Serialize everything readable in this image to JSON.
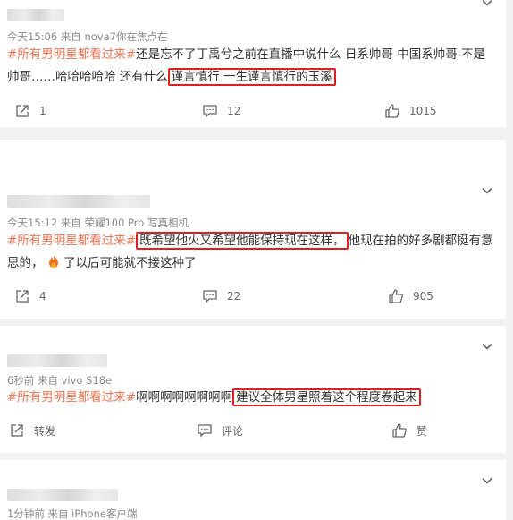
{
  "comments": [
    {
      "source": "今天15:06  来自 nova7你在焦点在",
      "topic": "#所有男明星都看过来#",
      "text_before": "还是忘不了丁禹兮之前在直播中说什么 日系帅哥 中国系帅哥 不是帅哥……哈哈哈哈哈 还有什么",
      "highlight": "谨言慎行 一生谨言慎行的玉溪",
      "text_after": "",
      "repost": "1",
      "comments": "12",
      "likes": "1015"
    },
    {
      "source": "今天15:12  来自 荣耀100 Pro 写真相机",
      "topic": "#所有男明星都看过来#",
      "highlight": "既希望他火又希望他能保持现在这样，",
      "text_after": "他现在拍的好多剧都挺有意思的，",
      "text_after2": "了以后可能就不接这种了",
      "repost": "4",
      "comments": "22",
      "likes": "905"
    },
    {
      "source": "6秒前  来自 vivo S18e",
      "topic": "#所有男明星都看过来#",
      "text_before": "啊啊啊啊啊啊啊啊",
      "highlight": "建议全体男星照着这个程度卷起来",
      "repost": "转发",
      "comments": "评论",
      "likes": "赞"
    },
    {
      "source": "1分钟前  来自 iPhone客户端"
    }
  ],
  "colors": {
    "topic": "#eb7350",
    "highlight_box": "#e02020"
  },
  "icons": [
    "repost-icon",
    "comment-icon",
    "like-icon",
    "chevron-down-icon",
    "fire-emoji"
  ]
}
